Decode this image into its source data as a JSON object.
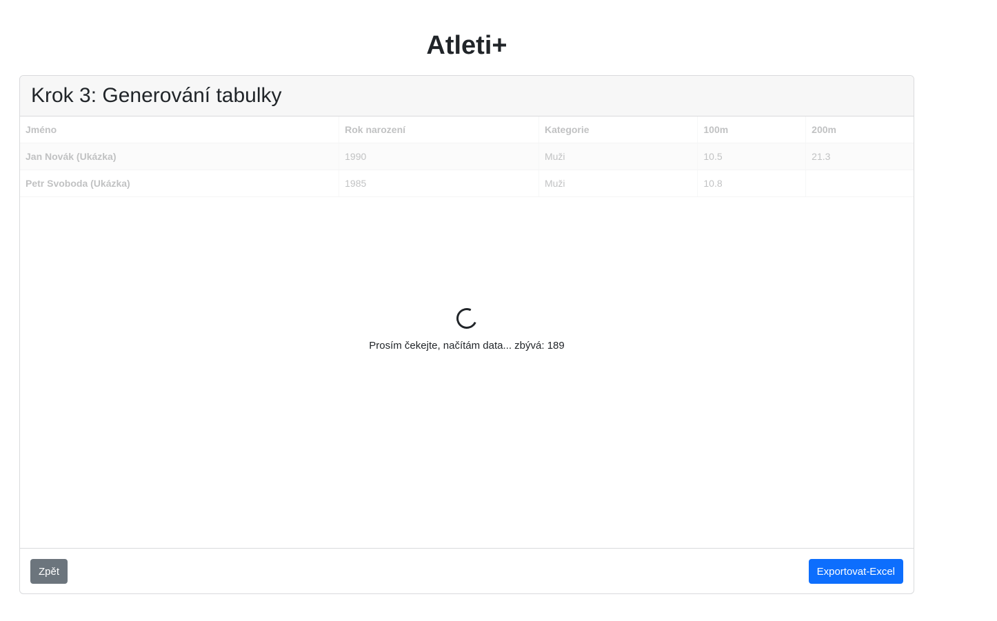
{
  "app": {
    "title": "Atleti+"
  },
  "card": {
    "title": "Krok 3: Generování tabulky"
  },
  "table": {
    "headers": {
      "name": "Jméno",
      "year": "Rok narození",
      "category": "Kategorie",
      "m100": "100m",
      "m200": "200m"
    },
    "rows": [
      {
        "name": "Jan Novák (Ukázka)",
        "year": "1990",
        "category": "Muži",
        "m100": "10.5",
        "m200": "21.3"
      },
      {
        "name": "Petr Svoboda (Ukázka)",
        "year": "1985",
        "category": "Muži",
        "m100": "10.8",
        "m200": ""
      }
    ]
  },
  "loader": {
    "text": "Prosím čekejte, načítám data... zbývá: 189"
  },
  "footer": {
    "back_label": "Zpět",
    "export_label": "Exportovat-Excel"
  },
  "colors": {
    "primary": "#0d6efd",
    "secondary": "#6c757d"
  },
  "icons": {
    "spinner": "loading-spinner-icon"
  }
}
